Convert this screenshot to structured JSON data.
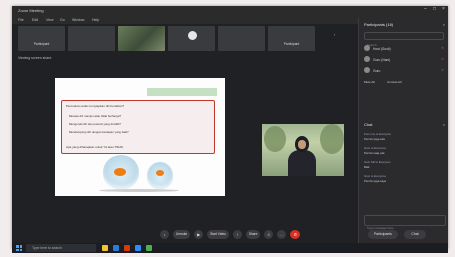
{
  "window": {
    "title": "Zoom Meeting",
    "menu": [
      "File",
      "Edit",
      "View",
      "Go",
      "Window",
      "Help"
    ]
  },
  "strip": {
    "tiles": [
      {
        "name": "Participant",
        "sub": ""
      },
      {
        "name": "",
        "sub": ""
      },
      {
        "name": "",
        "sub": ""
      },
      {
        "name": "",
        "sub": ""
      },
      {
        "name": "",
        "sub": ""
      },
      {
        "name": "Participant",
        "sub": ""
      }
    ],
    "next_label": "›"
  },
  "speaker_info": "Viewing screen share",
  "slide": {
    "header": "",
    "question": "Permainan anak menyiapkan diri bertahan?",
    "bullets": [
      "Merasa diri mampu atau tidak berharga?",
      "Mengenali diri dan potensi yang dimiliki?",
      "Mendampingi diri dengan kesiapan yang baik?"
    ],
    "footer": "Apa yang diharapkan untuk YA atau TIDAK"
  },
  "panel": {
    "participants_title": "Participants (16)",
    "search_placeholder": "Search",
    "participants": [
      {
        "name": "Host (Gusti)"
      },
      {
        "name": "Guru (Nani)"
      },
      {
        "name": "Guru"
      }
    ],
    "mute_all": "Mute All",
    "unmute_all": "Unmute All",
    "chat_title": "Chat",
    "chat_messages": [
      {
        "from": "From me to Everyone",
        "msg": "Permisi juga ada"
      },
      {
        "from": "Guru to Everyone",
        "msg": "Permisi saja pak"
      },
      {
        "from": "Guru Siti to Everyone",
        "msg": "Baik"
      },
      {
        "from": "Guru to Everyone",
        "msg": "Permisi juga saya"
      }
    ],
    "chat_input_placeholder": "Type message here...",
    "participants_button": "Participants",
    "chat_button": "Chat"
  },
  "controls": {
    "unmute": "Unmute",
    "start_video": "Start Video",
    "share": "Share",
    "leave": "✆"
  },
  "meeting_time": "",
  "taskbar": {
    "search_placeholder": "Type here to search",
    "time": "",
    "date": ""
  }
}
